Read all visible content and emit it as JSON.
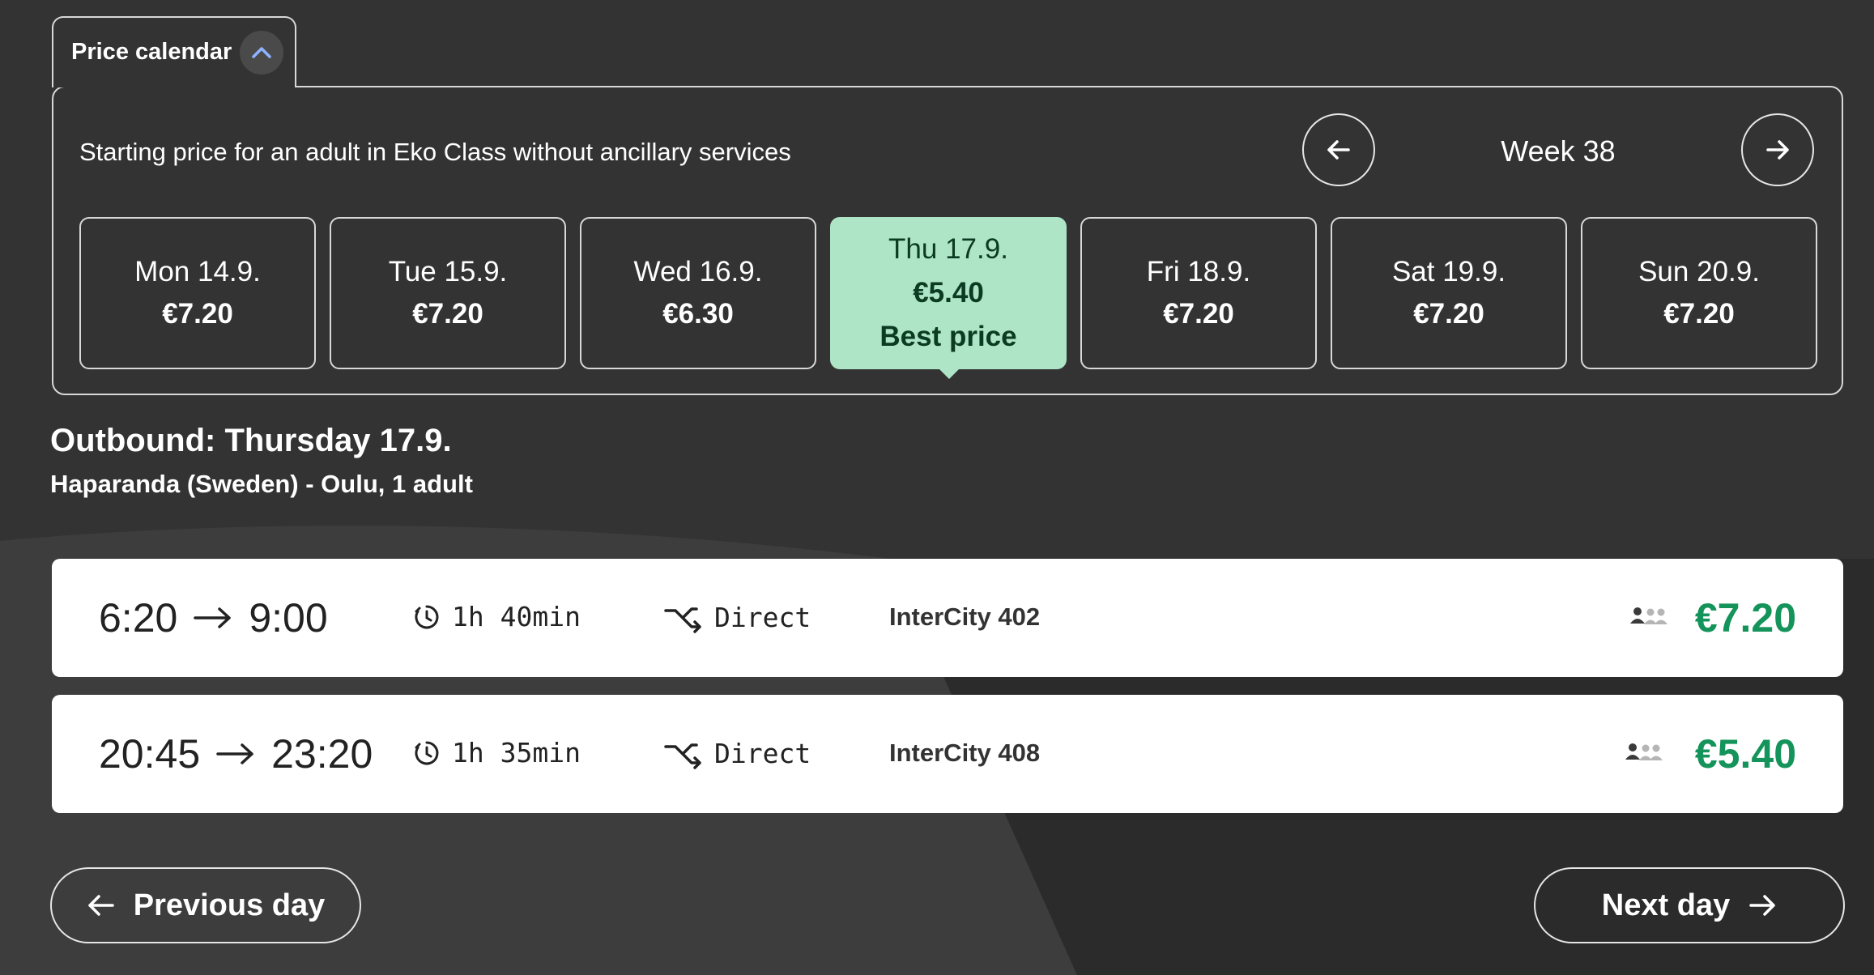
{
  "calendar": {
    "tab_label": "Price calendar",
    "description": "Starting price for an adult in Eko Class without ancillary services",
    "week_label": "Week 38",
    "days": [
      {
        "name": "Mon 14.9.",
        "price": "€7.20"
      },
      {
        "name": "Tue 15.9.",
        "price": "€7.20"
      },
      {
        "name": "Wed 16.9.",
        "price": "€6.30"
      },
      {
        "name": "Thu 17.9.",
        "price": "€5.40",
        "badge": "Best price"
      },
      {
        "name": "Fri 18.9.",
        "price": "€7.20"
      },
      {
        "name": "Sat 19.9.",
        "price": "€7.20"
      },
      {
        "name": "Sun 20.9.",
        "price": "€7.20"
      }
    ]
  },
  "outbound": {
    "title": "Outbound: Thursday 17.9.",
    "route": "Haparanda (Sweden) - Oulu, 1 adult"
  },
  "journeys": [
    {
      "depart": "6:20",
      "arrive": "9:00",
      "duration": "1h 40min",
      "connection": "Direct",
      "train": "InterCity 402",
      "price": "€7.20"
    },
    {
      "depart": "20:45",
      "arrive": "23:20",
      "duration": "1h 35min",
      "connection": "Direct",
      "train": "InterCity 408",
      "price": "€5.40"
    }
  ],
  "navigation": {
    "previous_day": "Previous day",
    "next_day": "Next day"
  },
  "icons": {
    "collapse": "chevron-up-icon",
    "week_prev": "arrow-left-icon",
    "week_next": "arrow-right-icon",
    "duration": "clock-icon",
    "connection": "direct-route-icon",
    "occupancy": "occupancy-icon"
  },
  "colors": {
    "background": "#333333",
    "selected_day": "#aee5c6",
    "price_green": "#14935a"
  }
}
